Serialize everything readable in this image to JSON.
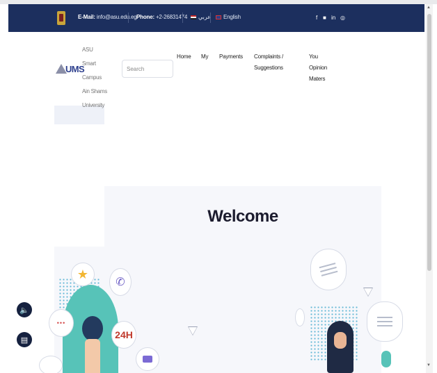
{
  "topbar": {
    "email_label": "E-Mail:",
    "email_value": "info@asu.edu.eg",
    "phone_label": "Phone:",
    "phone_value": "+2-26831474",
    "arabic_label": "عربي",
    "english_label": "English",
    "social_icons": [
      "facebook-icon",
      "youtube-icon",
      "linkedin-icon",
      "instagram-icon"
    ]
  },
  "brand": {
    "logo_text": "UMS",
    "name_lines": [
      "ASU Smart",
      "Campus",
      "Ain Shams",
      "University"
    ]
  },
  "search": {
    "placeholder": "Search"
  },
  "nav": {
    "home": "Home",
    "my": "My",
    "payments": "Payments",
    "complaints_line1": "Complaints /",
    "complaints_line2": "Suggestions",
    "opinion_line1": "You",
    "opinion_line2": "Opinion",
    "opinion_line3": "Maters"
  },
  "hero": {
    "welcome": "Welcome",
    "badge_24h": "24H",
    "chat_dots": "•••"
  },
  "colors": {
    "topbar": "#1c2f5e",
    "accent_teal": "#57c3b8",
    "hero_bg": "#f6f7fb"
  },
  "side_buttons": [
    "speaker-icon",
    "chat-icon"
  ]
}
